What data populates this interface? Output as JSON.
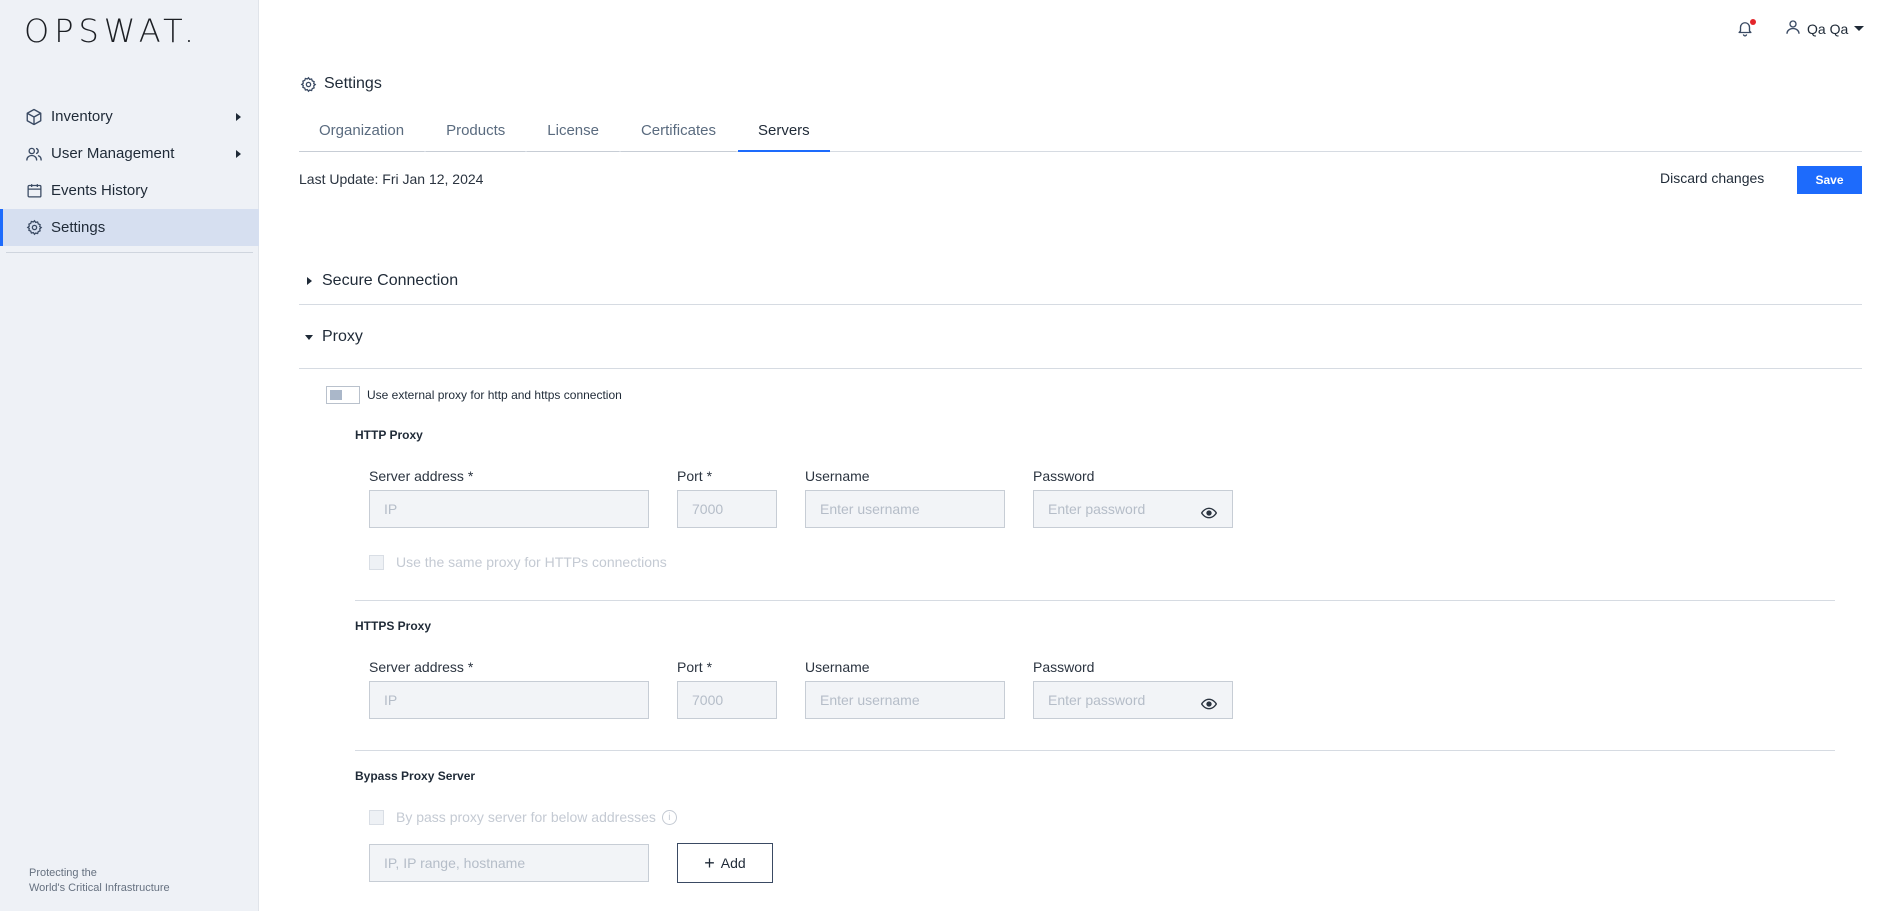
{
  "brand": {
    "logo_text": "OPSWAT.",
    "tagline_line1": "Protecting the",
    "tagline_line2": "World's Critical Infrastructure"
  },
  "sidebar": {
    "items": [
      {
        "label": "Inventory",
        "icon": "cube-icon",
        "has_caret": true
      },
      {
        "label": "User Management",
        "icon": "users-icon",
        "has_caret": true
      },
      {
        "label": "Events History",
        "icon": "calendar-icon",
        "has_caret": false
      },
      {
        "label": "Settings",
        "icon": "gear-icon",
        "has_caret": false,
        "active": true
      }
    ]
  },
  "header": {
    "user_name": "Qa Qa",
    "notification_icon": "bell-icon",
    "user_icon": "user-icon"
  },
  "page": {
    "title": "Settings"
  },
  "tabs": [
    {
      "label": "Organization"
    },
    {
      "label": "Products"
    },
    {
      "label": "License"
    },
    {
      "label": "Certificates"
    },
    {
      "label": "Servers",
      "active": true
    }
  ],
  "toolbar": {
    "last_update": "Last Update: Fri Jan 12, 2024",
    "discard_label": "Discard changes",
    "save_label": "Save"
  },
  "sections": {
    "secure_connection": {
      "title": "Secure Connection",
      "expanded": false
    },
    "proxy": {
      "title": "Proxy",
      "expanded": true,
      "toggle_label": "Use external proxy for http and https connection",
      "toggle_on": false,
      "http": {
        "title": "HTTP Proxy",
        "server_label": "Server address *",
        "server_placeholder": "IP",
        "port_label": "Port *",
        "port_placeholder": "7000",
        "username_label": "Username",
        "username_placeholder": "Enter username",
        "password_label": "Password",
        "password_placeholder": "Enter password",
        "same_proxy_label": "Use the same proxy for HTTPs connections"
      },
      "https": {
        "title": "HTTPS Proxy",
        "server_label": "Server address *",
        "server_placeholder": "IP",
        "port_label": "Port *",
        "port_placeholder": "7000",
        "username_label": "Username",
        "username_placeholder": "Enter username",
        "password_label": "Password",
        "password_placeholder": "Enter password"
      },
      "bypass": {
        "title": "Bypass Proxy Server",
        "checkbox_label": "By pass proxy server for below addresses",
        "input_placeholder": "IP, IP range, hostname",
        "add_label": "Add"
      }
    }
  },
  "colors": {
    "accent": "#1d6bfc",
    "sidebar_bg": "#eef1f6",
    "active_nav_bg": "#d6dff0",
    "notification_dot": "#e3262b"
  }
}
